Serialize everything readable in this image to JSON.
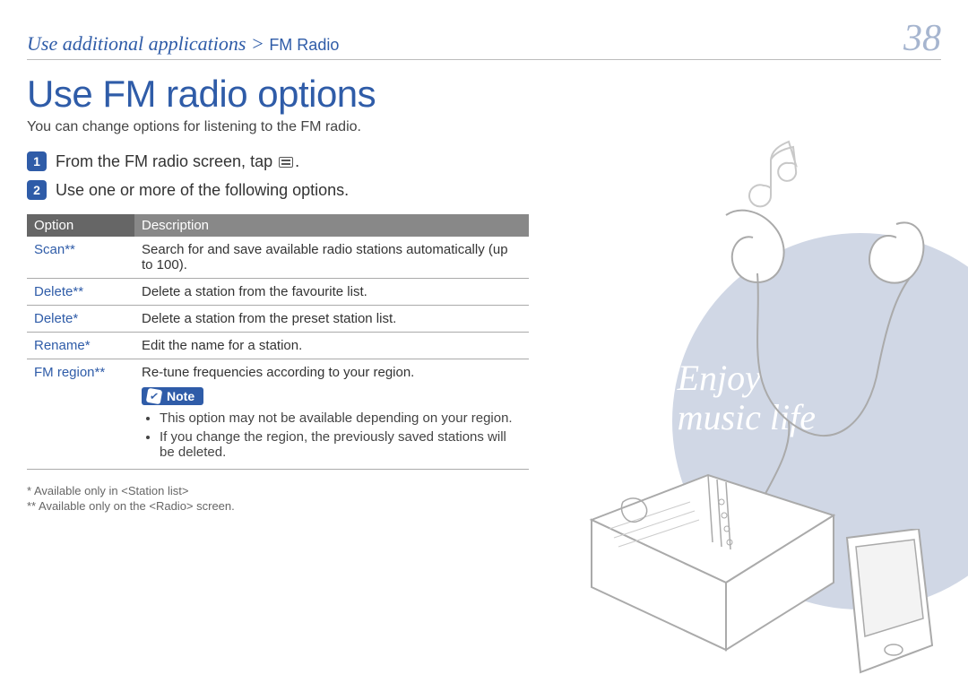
{
  "breadcrumb": {
    "main": "Use additional applications",
    "sep": ">",
    "sub": "FM Radio"
  },
  "page_number": "38",
  "heading": "Use FM radio options",
  "intro": "You can change options for listening to the FM radio.",
  "steps": {
    "s1_num": "1",
    "s1a": "From the FM radio screen, tap ",
    "s1b": ".",
    "s2_num": "2",
    "s2": "Use one or more of the following options."
  },
  "table": {
    "head_option": "Option",
    "head_desc": "Description",
    "rows": [
      {
        "option": "Scan**",
        "desc": "Search for and save available radio stations automatically (up to 100)."
      },
      {
        "option": "Delete**",
        "desc": "Delete a station from the favourite list."
      },
      {
        "option": "Delete*",
        "desc": "Delete a station from the preset station list."
      },
      {
        "option": "Rename*",
        "desc": "Edit the name for a station."
      }
    ],
    "fmregion": {
      "option": "FM region**",
      "desc_top": "Re-tune frequencies according to your region.",
      "note_label": "Note",
      "notes": [
        "This option may not be available depending on your region.",
        "If you change the region, the previously saved stations will be deleted."
      ]
    }
  },
  "footnotes": {
    "f1": "* Available only in <Station list>",
    "f2": "** Available only on the <Radio> screen."
  },
  "illustration": {
    "line1": "Enjoy",
    "line2": "music life"
  }
}
